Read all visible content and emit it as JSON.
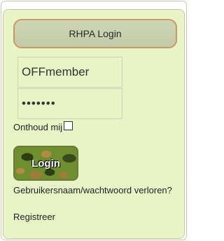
{
  "header": {
    "title": "RHPA Login"
  },
  "form": {
    "username_value": "OFFmember",
    "password_value": "•••••••",
    "remember_label": "Onthoud mij",
    "remember_checked": false,
    "login_label": "Login"
  },
  "links": {
    "lost_credentials": "Gebruikersnaam/wachtwoord verloren?",
    "register": "Registreer"
  },
  "colors": {
    "panel_background": "#e8f3c6",
    "header_border": "#c79a63",
    "header_background": "#c9d0ae"
  }
}
